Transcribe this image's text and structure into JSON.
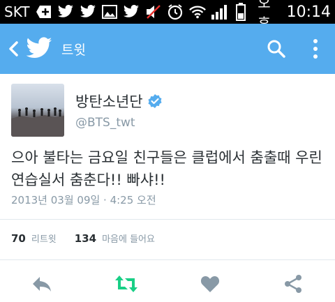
{
  "status_bar": {
    "carrier": "SKT",
    "ampm": "오후",
    "time": "10:14",
    "icons": [
      "plus-notification-icon",
      "twitter-icon",
      "twitter-icon",
      "image-icon",
      "twitter-icon",
      "mute-icon",
      "alarm-icon",
      "wifi-icon",
      "signal-icon",
      "battery-icon"
    ]
  },
  "app_bar": {
    "title": "트윗",
    "color": "#55acee"
  },
  "tweet": {
    "display_name": "방탄소년단",
    "handle": "@BTS_twt",
    "text": "으아 불타는 금요일 친구들은 클럽에서 춤출때 우린 연습실서 춤춘다!! 빠샤!!",
    "timestamp": "2013년 03월 09일 · 4:25 오전",
    "retweets": "70",
    "retweets_label": "리트윗",
    "likes": "134",
    "likes_label": "마음에 들어요"
  },
  "colors": {
    "action_icon": "#8899a6",
    "retweet_icon": "#19cf86",
    "verified": "#55acee"
  }
}
